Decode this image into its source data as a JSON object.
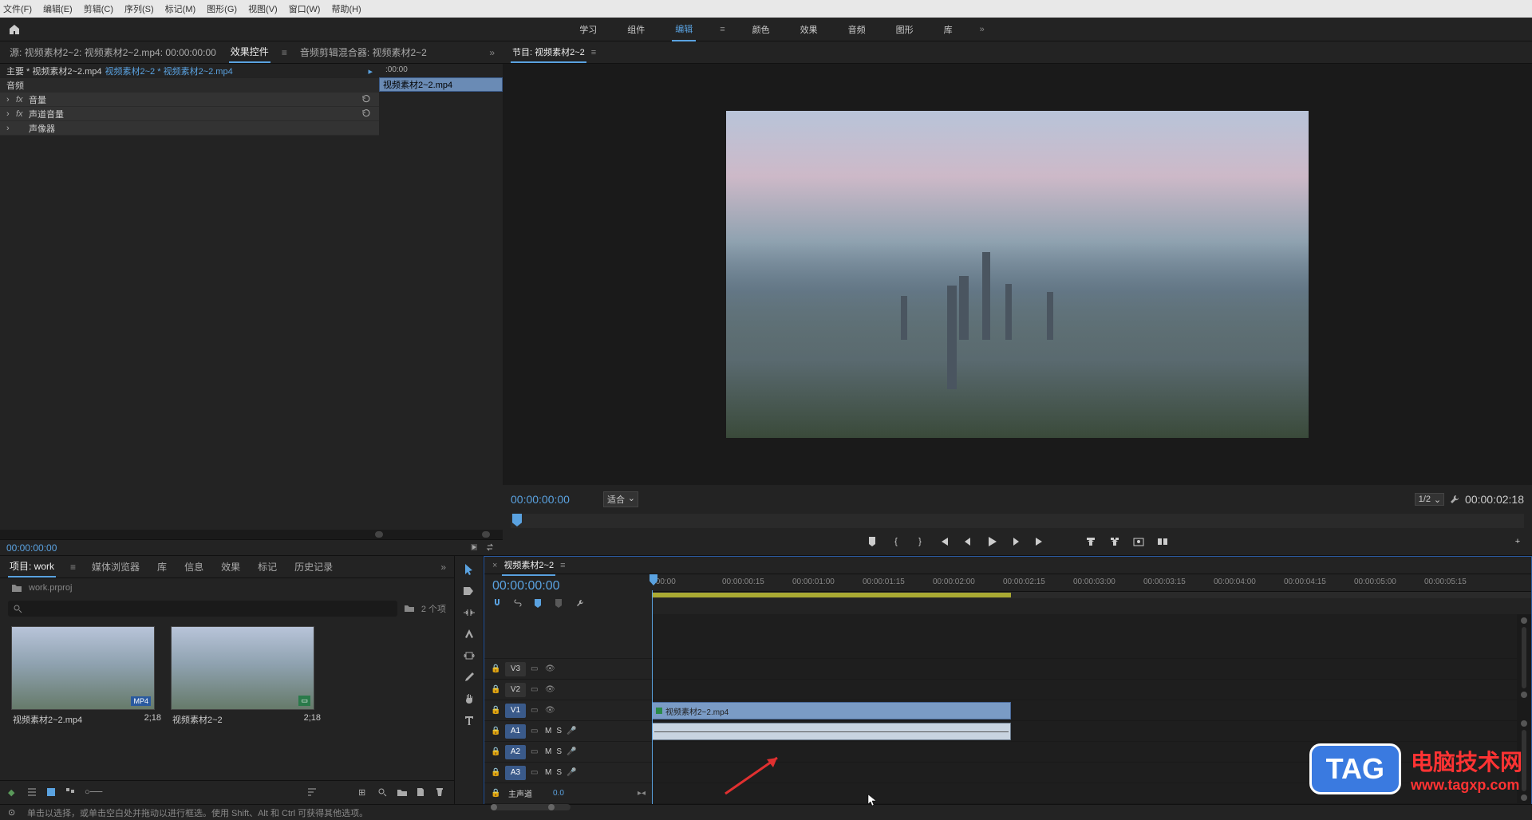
{
  "menu": {
    "file": "文件(F)",
    "edit": "编辑(E)",
    "clip": "剪辑(C)",
    "sequence": "序列(S)",
    "marker": "标记(M)",
    "graphics": "图形(G)",
    "view": "视图(V)",
    "window": "窗口(W)",
    "help": "帮助(H)"
  },
  "workspaces": {
    "learn": "学习",
    "assembly": "组件",
    "edit": "编辑",
    "color": "颜色",
    "effects": "效果",
    "audio": "音频",
    "graphics": "图形",
    "library": "库"
  },
  "source_panel": {
    "tab_source": "源: 视频素材2~2: 视频素材2~2.mp4: 00:00:00:00",
    "tab_effect": "效果控件",
    "tab_audio": "音频剪辑混合器: 视频素材2~2",
    "master_label": "主要 * 视频素材2~2.mp4",
    "master_link": "视频素材2~2 * 视频素材2~2.mp4",
    "mini_tc": ":00:00",
    "mini_clip": "视频素材2~2.mp4",
    "section_audio": "音频",
    "row_volume": "音量",
    "row_channel": "声道音量",
    "row_panner": "声像器",
    "tc": "00:00:00:00"
  },
  "program": {
    "tab": "节目: 视频素材2~2",
    "tc_left": "00:00:00:00",
    "fit": "适合",
    "scale": "1/2",
    "tc_right": "00:00:02:18"
  },
  "project": {
    "tab_project": "项目: work",
    "tab_media": "媒体浏览器",
    "tab_lib": "库",
    "tab_info": "信息",
    "tab_effects": "效果",
    "tab_marker": "标记",
    "tab_history": "历史记录",
    "file": "work.prproj",
    "count": "2 个项",
    "item1_name": "视频素材2~2.mp4",
    "item1_dur": "2;18",
    "item2_name": "视频素材2~2",
    "item2_dur": "2;18"
  },
  "timeline": {
    "tab": "视频素材2~2",
    "tc": "00:00:00:00",
    "ruler": [
      ":00:00",
      "00:00:00:15",
      "00:00:01:00",
      "00:00:01:15",
      "00:00:02:00",
      "00:00:02:15",
      "00:00:03:00",
      "00:00:03:15",
      "00:00:04:00",
      "00:00:04:15",
      "00:00:05:00",
      "00:00:05:15"
    ],
    "v3": "V3",
    "v2": "V2",
    "v1": "V1",
    "a1": "A1",
    "a2": "A2",
    "a3": "A3",
    "m": "M",
    "s": "S",
    "master": "主声道",
    "master_val": "0.0",
    "clip": "视频素材2~2.mp4"
  },
  "status": "单击以选择，或单击空白处并拖动以进行框选。使用 Shift、Alt 和 Ctrl 可获得其他选项。",
  "watermark": {
    "tag": "TAG",
    "line1": "电脑技术网",
    "line2": "www.tagxp.com"
  }
}
